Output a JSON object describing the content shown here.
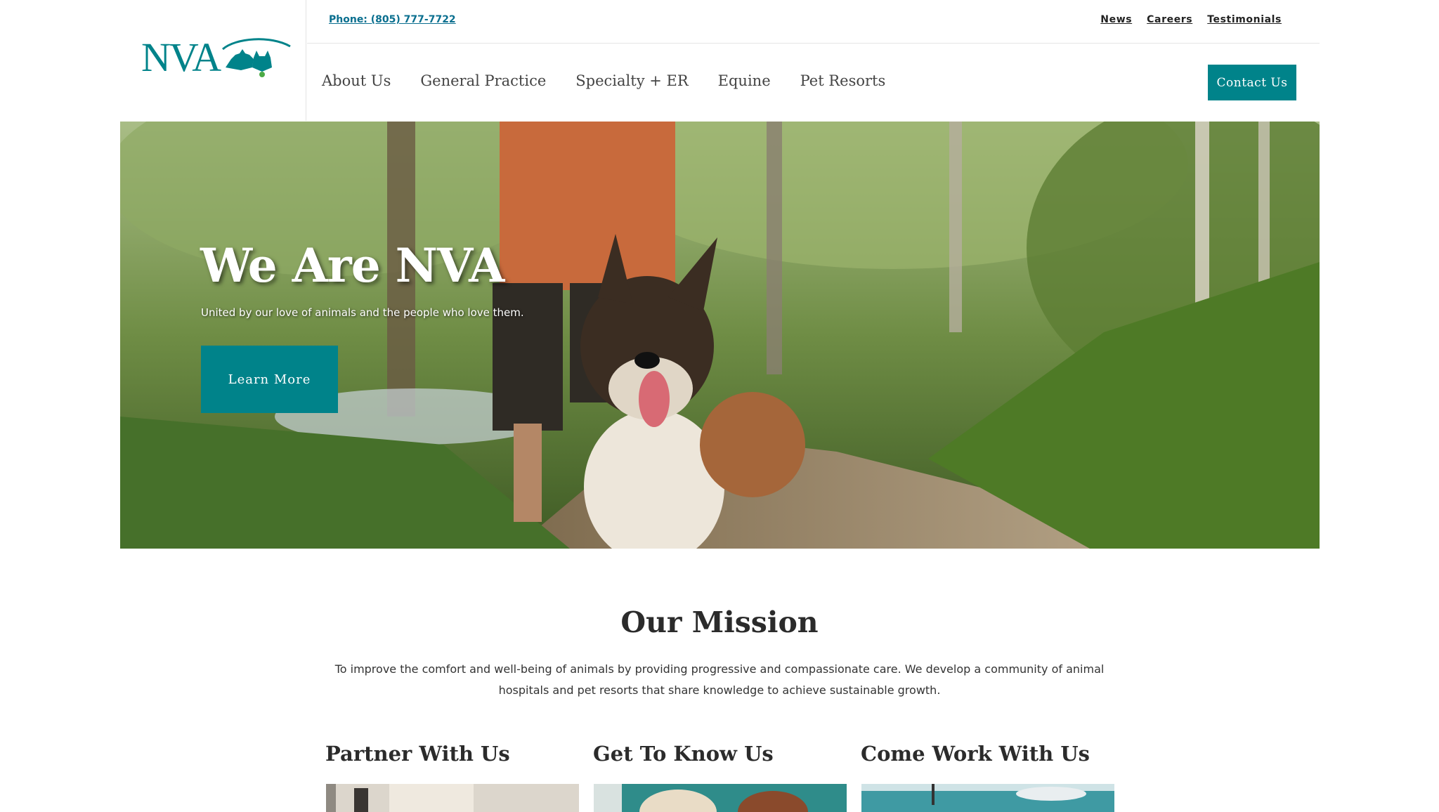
{
  "header": {
    "logo_text": "NVA",
    "phone": "Phone: (805) 777-7722",
    "top_links": [
      "News",
      "Careers",
      "Testimonials"
    ],
    "nav": [
      "About Us",
      "General Practice",
      "Specialty + ER",
      "Equine",
      "Pet Resorts"
    ],
    "contact_label": "Contact Us"
  },
  "hero": {
    "title": "We Are NVA",
    "subtitle": "United by our love of animals and the people who love them.",
    "button_label": "Learn More"
  },
  "mission": {
    "title": "Our Mission",
    "text": "To improve the comfort and well-being of animals by providing progressive and compassionate care. We develop a community of animal hospitals and pet resorts that share knowledge to achieve sustainable growth."
  },
  "cards": [
    {
      "title": "Partner With Us"
    },
    {
      "title": "Get To Know Us"
    },
    {
      "title": "Come Work With Us"
    }
  ],
  "colors": {
    "accent": "#00838a",
    "link": "#0a6f8f"
  }
}
